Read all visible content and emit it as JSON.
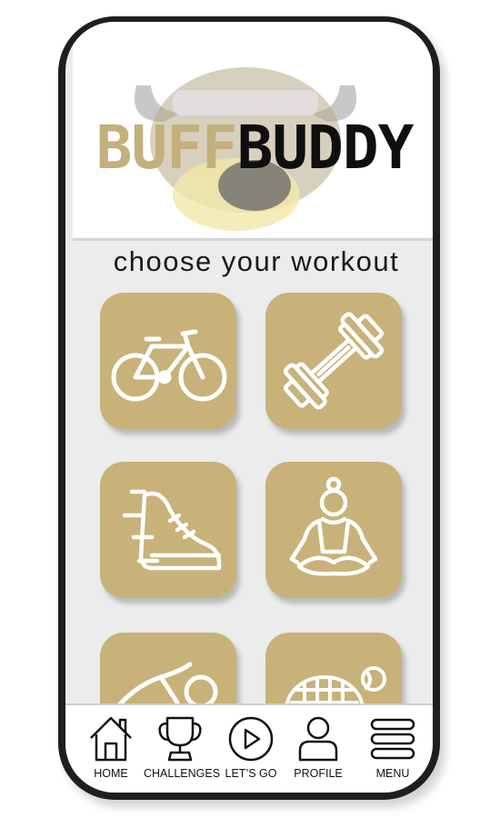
{
  "app": {
    "logo_part1": "BUFF",
    "logo_part2": "BUDDY",
    "heading": "choose your workout"
  },
  "colors": {
    "accent": "#c8b27a",
    "logo_gold": "#c4b07c",
    "frame": "#1e1e22",
    "screen_bg": "#ececec"
  },
  "workouts": [
    {
      "name": "cycling",
      "icon": "bicycle-icon"
    },
    {
      "name": "weightlifting",
      "icon": "dumbbell-icon"
    },
    {
      "name": "running",
      "icon": "running-shoe-icon"
    },
    {
      "name": "yoga",
      "icon": "yoga-icon"
    },
    {
      "name": "swimming",
      "icon": "swimmer-icon"
    },
    {
      "name": "tennis",
      "icon": "tennis-icon"
    }
  ],
  "tabbar": {
    "home": "HOME",
    "challenges": "CHALLENGES",
    "lets_go": "LET’S GO",
    "profile": "PROFILE",
    "menu": "MENU"
  }
}
